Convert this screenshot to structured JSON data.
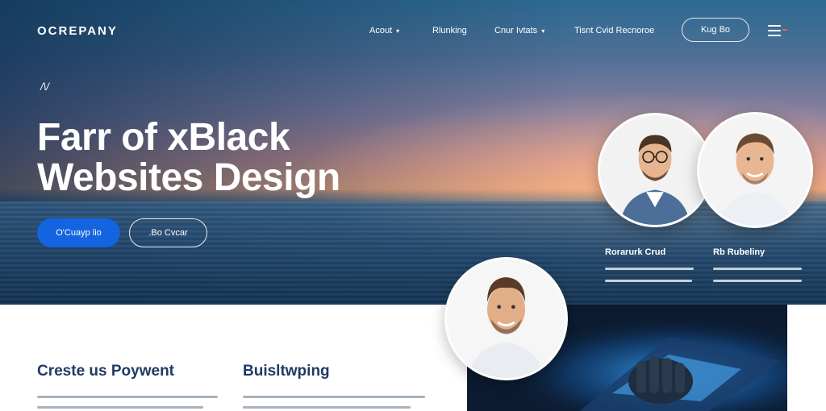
{
  "brand": {
    "name": "OCREPANY"
  },
  "nav": {
    "items": [
      {
        "label": "Acout",
        "has_dropdown": true
      },
      {
        "label": "Rlunking",
        "has_dropdown": false
      },
      {
        "label": "Cnur Ivtats",
        "has_dropdown": true
      },
      {
        "label": "Tisnt Cvid Recnoroe",
        "has_dropdown": false
      }
    ],
    "cta_label": "Kug Bo",
    "menu_icon": "hamburger-icon"
  },
  "hero": {
    "eyebrow": "/\\/",
    "headline_line1": "Farr of xBlack",
    "headline_line2": "Websites Design",
    "primary_button": "O'Cuayp lio",
    "secondary_button": ".Bo Cvcar",
    "colors": {
      "primary": "#1463e0",
      "accent_dot": "#ff5a5a"
    }
  },
  "team": [
    {
      "name": "Rorarurk Crud"
    },
    {
      "name": "Rb Rubeliny"
    }
  ],
  "features": [
    {
      "title": "Creste us Poywent"
    },
    {
      "title": "Buisltwping"
    }
  ]
}
